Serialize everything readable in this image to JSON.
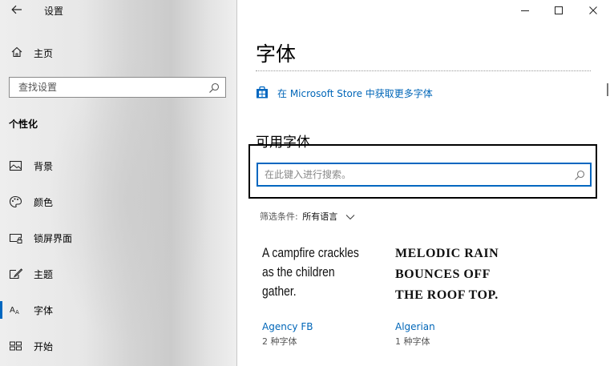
{
  "window": {
    "title": "设置",
    "controls": [
      "minimize",
      "maximize",
      "close"
    ]
  },
  "sidebar": {
    "home_label": "主页",
    "search_placeholder": "查找设置",
    "section_header": "个性化",
    "items": [
      {
        "label": "背景",
        "icon": "picture-icon",
        "selected": false
      },
      {
        "label": "颜色",
        "icon": "palette-icon",
        "selected": false
      },
      {
        "label": "锁屏界面",
        "icon": "lock-screen-icon",
        "selected": false
      },
      {
        "label": "主题",
        "icon": "brush-icon",
        "selected": false
      },
      {
        "label": "字体",
        "icon": "font-icon",
        "selected": true
      },
      {
        "label": "开始",
        "icon": "start-icon",
        "selected": false
      }
    ]
  },
  "main": {
    "page_title": "字体",
    "store_link": "在 Microsoft Store 中获取更多字体",
    "section_title": "可用字体",
    "font_search_placeholder": "在此键入进行搜索。",
    "filter": {
      "label": "筛选条件:",
      "value": "所有语言"
    },
    "fonts": [
      {
        "sample": "A campfire crackles\nas the children\ngather.",
        "name": "Agency FB",
        "count": "2 种字体"
      },
      {
        "sample": "MELODIC RAIN\nBOUNCES OFF\nTHE ROOF TOP.",
        "name": "Algerian",
        "count": "1 种字体"
      }
    ]
  },
  "colors": {
    "accent": "#0067c0",
    "link": "#0066b8"
  }
}
